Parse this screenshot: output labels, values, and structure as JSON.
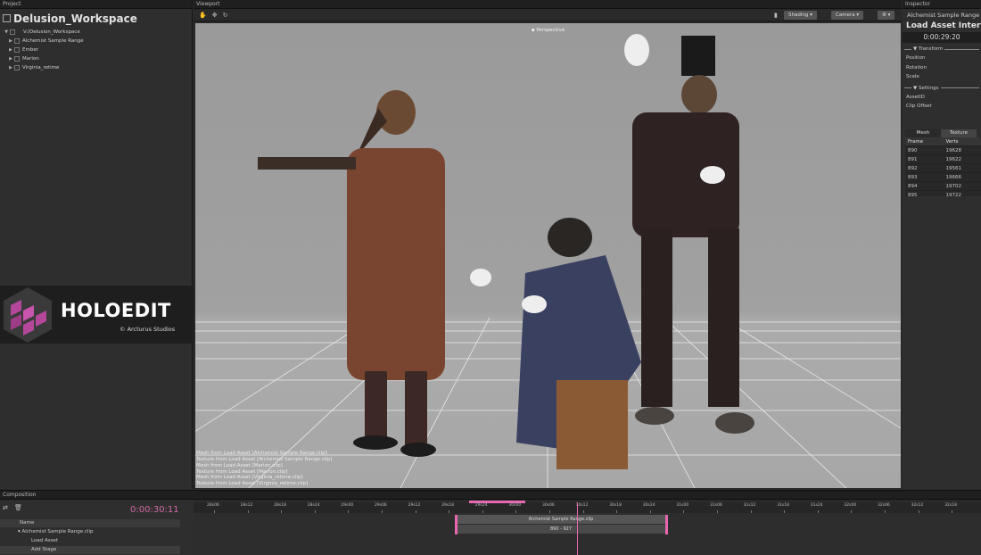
{
  "panels": {
    "project": "Project",
    "viewport": "Viewport",
    "inspector": "Inspector",
    "composition": "Composition"
  },
  "project": {
    "workspace_title": "Delusion_Workspace",
    "tree": [
      {
        "label": "V:/Delusion_Workspace",
        "expanded": true
      },
      {
        "label": "Alchemist Sample Range",
        "expanded": false
      },
      {
        "label": "Ember",
        "expanded": false
      },
      {
        "label": "Marion",
        "expanded": false
      },
      {
        "label": "Virginia_retime",
        "expanded": false
      }
    ]
  },
  "logo": {
    "wordmark": "HOLOEDIT",
    "sub": "© Arcturus Studios"
  },
  "viewport": {
    "shading_label": "Shading",
    "camera_label": "Camera",
    "perspective_label": "Perspective",
    "log": [
      "Mesh from Load Asset [Alchemist Sample Range.clip]",
      "Texture from Load Asset [Alchemist Sample Range.clip]",
      "Mesh from Load Asset [Marion.clip]",
      "Texture from Load Asset [Marion.clip]",
      "Mesh from Load Asset [Virginia_retime.clip]",
      "Texture from Load Asset [Virginia_retime.clip]"
    ]
  },
  "inspector": {
    "asset_name": "Alchemist Sample Range",
    "title": "Load Asset Interval",
    "time": "0:00:29:20",
    "transform_label": "Transform",
    "transform_props": [
      "Position",
      "Rotation",
      "Scale"
    ],
    "settings_label": "Settings",
    "settings_props": [
      "AssetID",
      "Clip Offset"
    ],
    "tabs": [
      "Mesh",
      "Texture"
    ],
    "frame_cols": [
      "Frame",
      "Verts"
    ],
    "frames": [
      [
        "890",
        "19628"
      ],
      [
        "891",
        "19622"
      ],
      [
        "892",
        "19561"
      ],
      [
        "893",
        "19666"
      ],
      [
        "894",
        "19702"
      ],
      [
        "895",
        "19722"
      ]
    ]
  },
  "composition": {
    "timecode": "0:00:30:11",
    "name_header": "Name",
    "rows": [
      "Alchemist Sample Range.clip",
      "Load Asset",
      "Add Stage"
    ],
    "ruler": [
      "28s06",
      "28s12",
      "28s18",
      "28s24",
      "29s00",
      "29s06",
      "29s12",
      "29s18",
      "29s24",
      "30s00",
      "30s06",
      "30s12",
      "30s18",
      "30s24",
      "31s00",
      "31s06",
      "31s12",
      "31s18",
      "31s24",
      "32s00",
      "32s06",
      "32s12",
      "32s18"
    ],
    "clip_label": "Alchemist Sample Range.clip",
    "clip_range": "890 - 927"
  },
  "colors": {
    "accent": "#e667b0",
    "logo": "#b5479b"
  }
}
